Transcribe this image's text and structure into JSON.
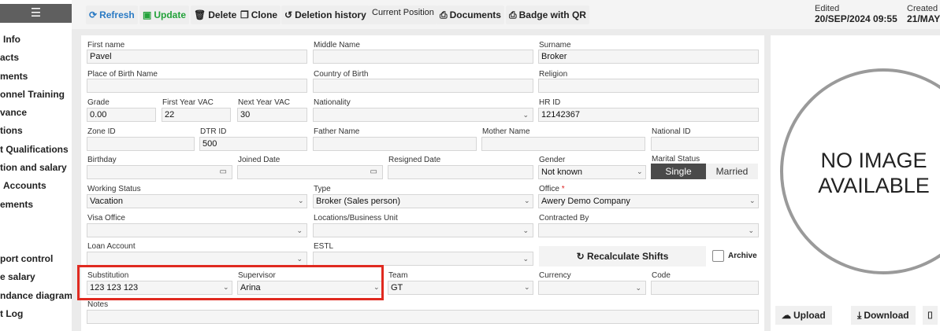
{
  "sidebar": {
    "menu_icon": "hamburger-icon",
    "items": [
      "Info",
      "acts",
      "ments",
      "onnel Training",
      "vance",
      "tions",
      "t Qualifications",
      "tion and salary",
      "Accounts",
      "ements"
    ],
    "items2": [
      "port control",
      "e salary",
      "ndance diagram",
      "t Log"
    ]
  },
  "toolbar": {
    "refresh": "Refresh",
    "update": "Update",
    "delete": "Delete",
    "clone": "Clone",
    "deletion_history": "Deletion history",
    "current_position": "Current Position",
    "documents": "Documents",
    "badge_qr": "Badge with QR",
    "edited_label": "Edited",
    "edited_value": "20/SEP/2024 09:55",
    "created_label": "Created",
    "created_value": "21/MAY/"
  },
  "form": {
    "first_name_label": "First name",
    "first_name": "Pavel",
    "middle_name_label": "Middle Name",
    "middle_name": "",
    "surname_label": "Surname",
    "surname": "Broker",
    "place_of_birth_label": "Place of Birth Name",
    "country_of_birth_label": "Country of Birth",
    "religion_label": "Religion",
    "grade_label": "Grade",
    "grade": "0.00",
    "first_year_vac_label": "First Year VAC",
    "first_year_vac": "22",
    "next_year_vac_label": "Next Year VAC",
    "next_year_vac": "30",
    "nationality_label": "Nationality",
    "hr_id_label": "HR ID",
    "hr_id": "12142367",
    "zone_id_label": "Zone ID",
    "dtr_id_label": "DTR ID",
    "dtr_id": "500",
    "father_name_label": "Father Name",
    "mother_name_label": "Mother Name",
    "national_id_label": "National ID",
    "birthday_label": "Birthday",
    "joined_date_label": "Joined Date",
    "resigned_date_label": "Resigned Date",
    "gender_label": "Gender",
    "gender": "Not known",
    "marital_status_label": "Marital Status",
    "marital_single": "Single",
    "marital_married": "Married",
    "working_status_label": "Working Status",
    "working_status": "Vacation",
    "type_label": "Type",
    "type": "Broker (Sales person)",
    "office_label": "Office",
    "office_required": "*",
    "office": "Awery Demo Company",
    "visa_office_label": "Visa Office",
    "locations_label": "Locations/Business Unit",
    "contracted_by_label": "Contracted By",
    "loan_account_label": "Loan Account",
    "estl_label": "ESTL",
    "recalculate": "Recalculate Shifts",
    "archive_label": "Archive",
    "substitution_label": "Substitution",
    "substitution": "123 123 123",
    "supervisor_label": "Supervisor",
    "supervisor": "Arina",
    "team_label": "Team",
    "team": "GT",
    "currency_label": "Currency",
    "code_label": "Code",
    "notes_label": "Notes"
  },
  "image_panel": {
    "no_image_line1": "NO IMAGE",
    "no_image_line2": "AVAILABLE",
    "upload": "Upload",
    "download": "Download"
  }
}
